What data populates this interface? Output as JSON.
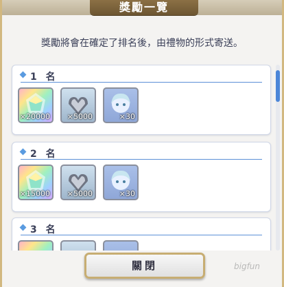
{
  "dialog": {
    "title": "獎勵一覽",
    "subtitle": "獎勵將會在確定了排名後，由禮物的形式寄送。",
    "close_label": "關閉"
  },
  "ranks": [
    {
      "label": "1 名",
      "items": [
        {
          "type": "rainbow-crystal",
          "icon": "rainbow-gem-icon",
          "qty": "×20000"
        },
        {
          "type": "silver-heart-crystal",
          "icon": "silver-crystal-icon",
          "qty": "×5000"
        },
        {
          "type": "character-portrait",
          "icon": "character-portrait-icon",
          "qty": "×30"
        }
      ]
    },
    {
      "label": "2 名",
      "items": [
        {
          "type": "rainbow-crystal",
          "icon": "rainbow-gem-icon",
          "qty": "×15000"
        },
        {
          "type": "silver-heart-crystal",
          "icon": "silver-crystal-icon",
          "qty": "×5000"
        },
        {
          "type": "character-portrait",
          "icon": "character-portrait-icon",
          "qty": "×30"
        }
      ]
    },
    {
      "label": "3 名",
      "items": []
    }
  ],
  "watermark": "bigfun",
  "colors": {
    "accent": "#4c86d8",
    "title_bg": "#7a6138",
    "border_gold": "#d2b880"
  }
}
